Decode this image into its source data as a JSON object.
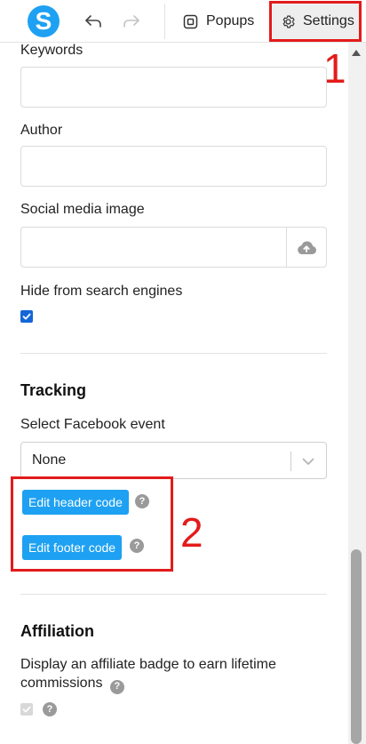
{
  "topbar": {
    "logo_letter": "S",
    "popups_label": "Popups",
    "settings_label": "Settings"
  },
  "seo": {
    "keywords_label": "Keywords",
    "keywords_value": "",
    "author_label": "Author",
    "author_value": "",
    "social_image_label": "Social media image",
    "social_image_value": "",
    "hide_label": "Hide from search engines",
    "hide_checked": true
  },
  "tracking": {
    "title": "Tracking",
    "fb_event_label": "Select Facebook event",
    "fb_event_value": "None",
    "edit_header_label": "Edit header code",
    "edit_footer_label": "Edit footer code"
  },
  "affiliation": {
    "title": "Affiliation",
    "description": "Display an affiliate badge to earn lifetime commissions",
    "badge_checked": true
  },
  "annotations": {
    "one": "1",
    "two": "2",
    "color": "#e31b1b"
  },
  "help_glyph": "?",
  "icons": {
    "undo": "undo-icon",
    "redo": "redo-icon",
    "popups": "popup-square-icon",
    "settings": "gear-icon",
    "upload": "cloud-upload-icon",
    "dropdown": "chevron-down-icon",
    "help": "question-circle-icon",
    "check": "check-icon"
  },
  "colors": {
    "brand": "#1ea1f2",
    "checkbox": "#1565d8",
    "annotation": "#e31b1b"
  }
}
